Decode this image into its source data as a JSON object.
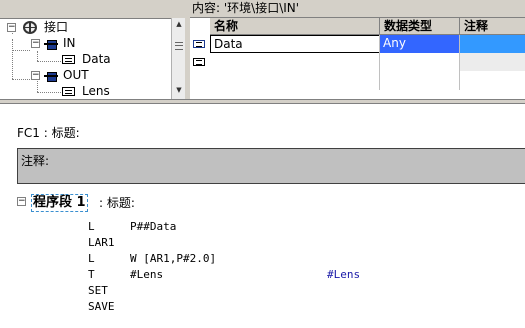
{
  "content_bar": {
    "text": "内容: '环境\\接口\\IN'"
  },
  "tree": {
    "root": {
      "label": "接口",
      "expander": "−"
    },
    "nodes": [
      {
        "label": "IN",
        "expander": "−"
      },
      {
        "label": "Data"
      },
      {
        "label": "OUT",
        "expander": "−"
      },
      {
        "label": "Lens"
      }
    ],
    "scroll_up": "▲",
    "scroll_down": "▼"
  },
  "grid": {
    "columns": [
      "名称",
      "数据类型",
      "注释"
    ],
    "rows": [
      {
        "name": "Data",
        "type": "Any",
        "comment": ""
      }
    ]
  },
  "editor": {
    "block_title": "FC1 : 标题:",
    "comment_label": "注释:",
    "network": {
      "expander": "−",
      "label": "程序段 1",
      "title": ": 标题:"
    },
    "stl_lines": [
      {
        "op": "L",
        "arg": "P##Data",
        "comment": ""
      },
      {
        "op": "LAR1",
        "arg": "",
        "comment": ""
      },
      {
        "op": "L",
        "arg": "W [AR1,P#2.0]",
        "comment": ""
      },
      {
        "op": "T",
        "arg": "#Lens",
        "comment": "#Lens"
      },
      {
        "op": "SET",
        "arg": "",
        "comment": ""
      },
      {
        "op": "SAVE",
        "arg": "",
        "comment": ""
      }
    ]
  },
  "colors": {
    "selection_blue": "#3366ff",
    "comment_box_gray": "#c0c0c0",
    "panel_gray": "#d4d0c8",
    "comment_text_blue": "#1a1aa8"
  }
}
